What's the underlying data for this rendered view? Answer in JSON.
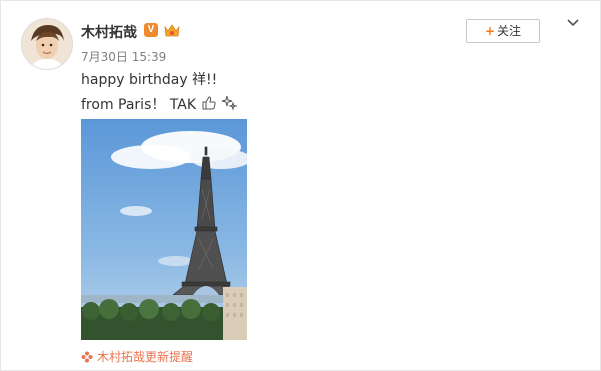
{
  "post": {
    "username": "木村拓哉",
    "verified_badge": "V",
    "timestamp": "7月30日 15:39",
    "text_line1": "happy birthday 祥!!",
    "text_line2": "from Paris！ TAK",
    "photo_subject": "eiffel-tower",
    "source_label": "木村拓哉更新提醒"
  },
  "actions": {
    "follow_plus": "+",
    "follow_label": "关注"
  },
  "colors": {
    "accent_orange": "#f27b1c",
    "link_orange": "#eb7350",
    "text": "#333333",
    "meta": "#808080",
    "sky": "#7fb0e0"
  }
}
